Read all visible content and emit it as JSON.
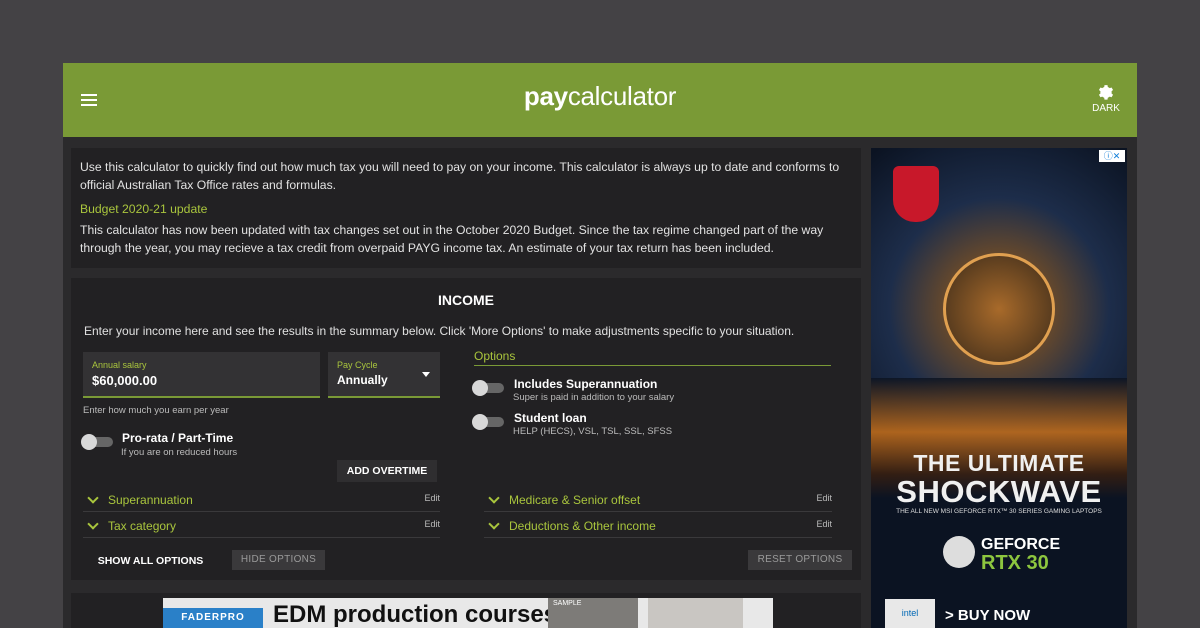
{
  "header": {
    "logo_bold": "pay",
    "logo_rest": "calculator",
    "dark_label": "DARK"
  },
  "intro": {
    "text": "Use this calculator to quickly find out how much tax you will need to pay on your income. This calculator is always up to date and conforms to official Australian Tax Office rates and formulas.",
    "update_title": "Budget 2020-21 update",
    "update_text": "This calculator has now been updated with tax changes set out in the October 2020 Budget. Since the tax regime changed part of the way through the year, you may recieve a tax credit from overpaid PAYG income tax. An estimate of your tax return has been included."
  },
  "income": {
    "title": "INCOME",
    "description": "Enter your income here and see the results in the summary below. Click 'More Options' to make adjustments specific to your situation.",
    "salary_label": "Annual salary",
    "salary_value": "$60,000.00",
    "salary_hint": "Enter how much you earn per year",
    "cycle_label": "Pay Cycle",
    "cycle_value": "Annually",
    "prorata_title": "Pro-rata / Part-Time",
    "prorata_sub": "If you are on reduced hours",
    "overtime_label": "ADD OVERTIME",
    "options_title": "Options",
    "super_title": "Includes Superannuation",
    "super_sub": "Super is paid in addition to your salary",
    "loan_title": "Student loan",
    "loan_sub": "HELP (HECS), VSL, TSL, SSL, SFSS"
  },
  "accordions": [
    {
      "title": "Superannuation",
      "edit": "Edit"
    },
    {
      "title": "Tax category",
      "edit": "Edit"
    },
    {
      "title": "Medicare & Senior offset",
      "edit": "Edit"
    },
    {
      "title": "Deductions & Other income",
      "edit": "Edit"
    }
  ],
  "buttons": {
    "show_all": "SHOW ALL OPTIONS",
    "hide": "HIDE OPTIONS",
    "reset": "RESET OPTIONS"
  },
  "ad_side": {
    "headline1": "THE ULTIMATE",
    "headline2": "SHOCKWAVE",
    "sub": "THE ALL NEW MSI GEFORCE RTX™ 30 SERIES GAMING LAPTOPS",
    "gpu_brand": "GEFORCE",
    "gpu_model": "RTX 30",
    "intel": "intel",
    "cta": "> BUY NOW",
    "close": "ⓘ✕"
  },
  "ad_bottom": {
    "brand": "FADERPRO",
    "headline": "EDM production courses",
    "thumb_text": "SAMPLE"
  }
}
